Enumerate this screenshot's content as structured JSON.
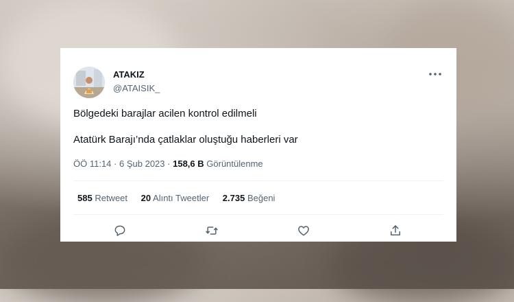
{
  "tweet": {
    "author_name": "ATAKIZ",
    "author_handle": "@ATAISIK_",
    "lines": [
      "Bölgedeki barajlar acilen kontrol edilmeli",
      "Atatürk Barajı’nda çatlaklar oluştuğu haberleri var"
    ],
    "time": "ÖÖ 11:14",
    "separator": "·",
    "date": "6 Şub 2023",
    "views_count": "158,6 B",
    "views_label": "Görüntülenme"
  },
  "stats": [
    {
      "count": "585",
      "label": "Retweet"
    },
    {
      "count": "20",
      "label": "Alıntı Tweetler"
    },
    {
      "count": "2.735",
      "label": "Beğeni"
    }
  ],
  "icons": {
    "more": "more-horizontal-icon",
    "reply": "reply-icon",
    "retweet": "retweet-icon",
    "like": "heart-icon",
    "share": "share-icon"
  },
  "colors": {
    "text_primary": "#0f1419",
    "text_secondary": "#536471",
    "divider": "#eff3f4",
    "card_background": "#ffffff"
  }
}
